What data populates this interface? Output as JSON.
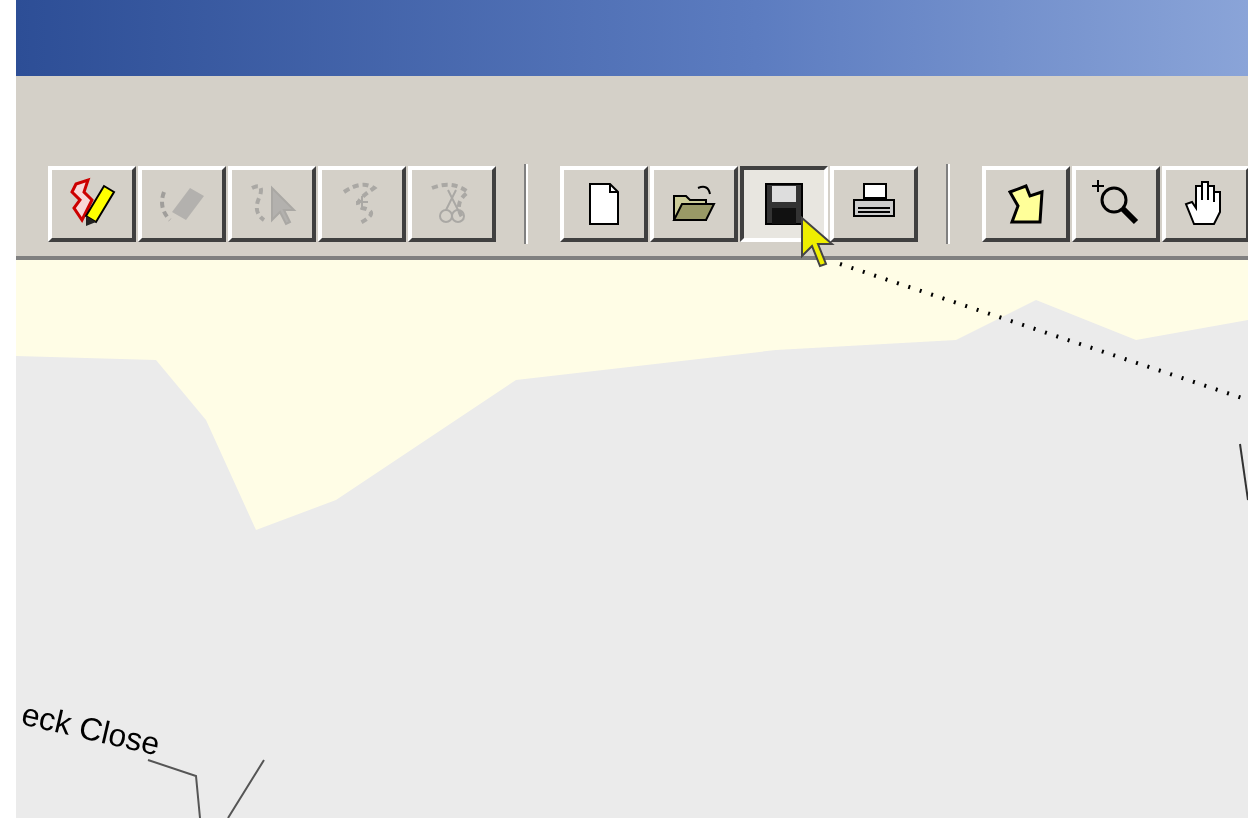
{
  "toolbar": {
    "groups": [
      {
        "buttons": [
          {
            "kind": "edit-shape",
            "disabled": false,
            "pressed": false
          },
          {
            "kind": "eraser",
            "disabled": true,
            "pressed": false
          },
          {
            "kind": "select-vertex",
            "disabled": true,
            "pressed": false
          },
          {
            "kind": "add-vertex",
            "disabled": true,
            "pressed": false
          },
          {
            "kind": "split",
            "disabled": true,
            "pressed": false
          }
        ]
      },
      {
        "buttons": [
          {
            "kind": "new",
            "disabled": false,
            "pressed": false
          },
          {
            "kind": "open",
            "disabled": false,
            "pressed": false
          },
          {
            "kind": "save",
            "disabled": false,
            "pressed": true
          },
          {
            "kind": "print",
            "disabled": false,
            "pressed": false
          }
        ]
      },
      {
        "buttons": [
          {
            "kind": "polygon",
            "disabled": false,
            "pressed": false
          },
          {
            "kind": "zoom-in",
            "disabled": false,
            "pressed": false
          },
          {
            "kind": "pan",
            "disabled": false,
            "pressed": false
          }
        ]
      }
    ]
  },
  "map": {
    "labels": [
      {
        "text": "eck Close"
      }
    ]
  }
}
